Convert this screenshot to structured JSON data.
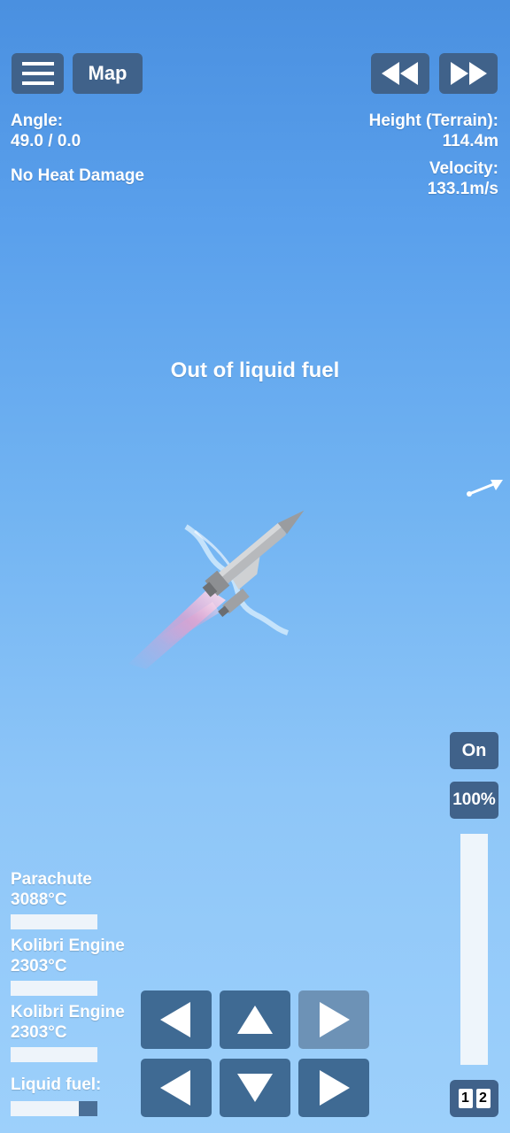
{
  "map_label": "Map",
  "telemetry": {
    "angle_label": "Angle:",
    "angle_value": "49.0 / 0.0",
    "heat_status": "No Heat Damage",
    "height_label": "Height (Terrain):",
    "height_value": "114.4m",
    "velocity_label": "Velocity:",
    "velocity_value": "133.1m/s"
  },
  "message": "Out of liquid fuel",
  "throttle": {
    "toggle_label": "On",
    "percent_label": "100%",
    "level": 1.0
  },
  "stage_labels": [
    "1",
    "2"
  ],
  "parts": [
    {
      "name": "Parachute",
      "temp": "3088°C",
      "fill": 0
    },
    {
      "name": "Kolibri Engine",
      "temp": "2303°C",
      "fill": 0
    },
    {
      "name": "Kolibri Engine",
      "temp": "2303°C",
      "fill": 0
    }
  ],
  "fuel": {
    "label": "Liquid fuel:",
    "fill": 0.21
  },
  "colors": {
    "button_bg": "#40628a",
    "sky_top": "#4a90e0",
    "sky_bottom": "#9dd0fb"
  }
}
